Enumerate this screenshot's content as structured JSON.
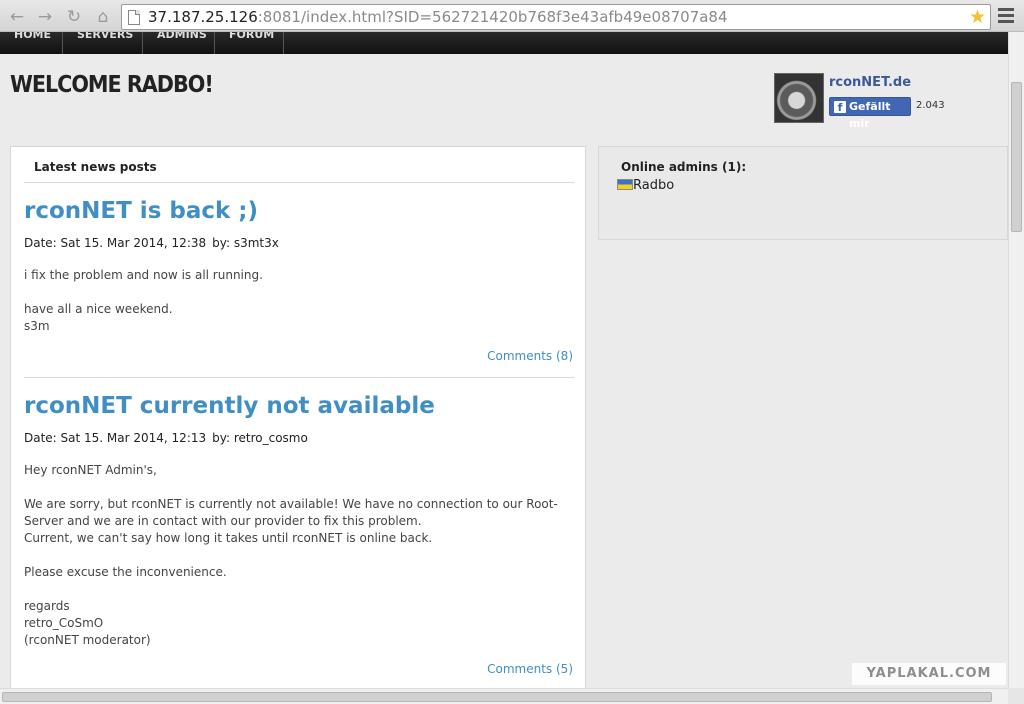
{
  "browser": {
    "url_host": "37.187.25.126",
    "url_rest": ":8081/index.html?SID=562721420b768f3e43afb49e08707a84",
    "back_icon": "back-arrow-icon",
    "forward_icon": "forward-arrow-icon",
    "reload_icon": "reload-icon",
    "home_icon": "home-icon",
    "bookmark_icon": "star-icon"
  },
  "nav": {
    "items": [
      "Home",
      "Servers",
      "Admins",
      "Forum"
    ]
  },
  "header": {
    "welcome": "WELCOME RADBO!"
  },
  "facebook": {
    "page_name": "rconNET.de",
    "like_label": "Gefällt mir",
    "like_count": "2.043"
  },
  "news": {
    "section_title": "Latest news posts",
    "posts": [
      {
        "title": "rconNET is back ;)",
        "date": "Date: Sat 15. Mar 2014, 12:38",
        "author": "by: s3mt3x",
        "lines": [
          "i fix the problem and now is all running.",
          "",
          "have all a nice weekend.",
          "s3m"
        ],
        "comments": "Comments (8)"
      },
      {
        "title": "rconNET currently not available",
        "date": "Date: Sat 15. Mar 2014, 12:13",
        "author": "by: retro_cosmo",
        "lines": [
          "Hey rconNET Admin's,",
          "",
          "We are sorry, but rconNET is currently not available! We have no connection to our Root-",
          "Server and we are in contact with our provider to fix this problem.",
          "Current, we can't say how long it takes until rconNET is online back.",
          "",
          "Please excuse the inconvenience.",
          "",
          "regards",
          "retro_CoSmO",
          "(rconNET moderator)"
        ],
        "comments": "Comments (5)"
      }
    ]
  },
  "online": {
    "title": "Online admins (1):",
    "admins": [
      "Radbo"
    ]
  },
  "watermark": "YAPLAKAL.COM"
}
